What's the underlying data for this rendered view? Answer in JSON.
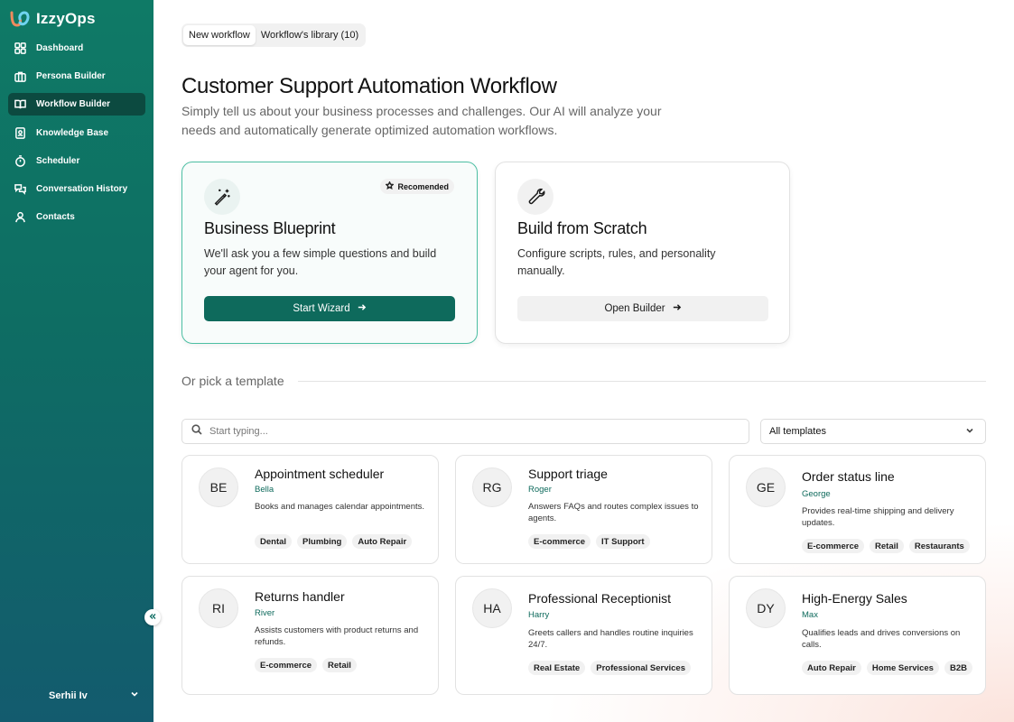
{
  "app": {
    "name": "IzzyOps"
  },
  "sidebar": {
    "items": [
      {
        "label": "Dashboard",
        "icon": "dashboard-grid-icon",
        "active": false
      },
      {
        "label": "Persona Builder",
        "icon": "briefcase-icon",
        "active": false
      },
      {
        "label": "Workflow Builder",
        "icon": "book-open-icon",
        "active": true
      },
      {
        "label": "Knowledge Base",
        "icon": "notebook-icon",
        "active": false
      },
      {
        "label": "Scheduler",
        "icon": "stopwatch-icon",
        "active": false
      },
      {
        "label": "Conversation History",
        "icon": "chat-bubbles-icon",
        "active": false
      },
      {
        "label": "Contacts",
        "icon": "person-icon",
        "active": false
      }
    ],
    "user_name": "Serhii Iv"
  },
  "tabs": [
    {
      "label": "New workflow",
      "active": true
    },
    {
      "label": "Workflow's library (10)",
      "active": false
    }
  ],
  "page": {
    "title": "Customer Support Automation Workflow",
    "subtitle": "Simply tell us about your business processes and challenges. Our AI will analyze your needs and automatically generate optimized automation workflows."
  },
  "options": {
    "blueprint": {
      "badge": "Recomended",
      "title": "Business Blueprint",
      "description": "We'll ask you a few simple questions and build your agent for you.",
      "button": "Start Wizard"
    },
    "scratch": {
      "title": "Build from Scratch",
      "description": "Configure scripts, rules, and personality manually.",
      "button": "Open Builder"
    }
  },
  "templates_section": {
    "heading": "Or pick a template",
    "search_placeholder": "Start typing...",
    "filter_value": "All templates"
  },
  "templates": [
    {
      "initials": "BE",
      "name": "Appointment scheduler",
      "persona": "Bella",
      "description": "Books and manages calendar appointments.",
      "tags": [
        "Dental",
        "Plumbing",
        "Auto Repair"
      ]
    },
    {
      "initials": "RG",
      "name": "Support triage",
      "persona": "Roger",
      "description": "Answers FAQs and routes complex issues to agents.",
      "tags": [
        "E-commerce",
        "IT Support"
      ]
    },
    {
      "initials": "GE",
      "name": "Order status line",
      "persona": "George",
      "description": "Provides real-time shipping and delivery updates.",
      "tags": [
        "E-commerce",
        "Retail",
        "Restaurants"
      ]
    },
    {
      "initials": "RI",
      "name": "Returns handler",
      "persona": "River",
      "description": "Assists customers with product returns and refunds.",
      "tags": [
        "E-commerce",
        "Retail"
      ]
    },
    {
      "initials": "HA",
      "name": "Professional Receptionist",
      "persona": "Harry",
      "description": "Greets callers and handles routine inquiries 24/7.",
      "tags": [
        "Real Estate",
        "Professional Services"
      ]
    },
    {
      "initials": "DY",
      "name": "High-Energy Sales",
      "persona": "Max",
      "description": "Qualifies leads and drives conversions on calls.",
      "tags": [
        "Auto Repair",
        "Home Services",
        "B2B"
      ]
    }
  ],
  "colors": {
    "sidebar_top": "#0f7a66",
    "sidebar_bottom": "#135b6e",
    "accent": "#0e6a5c",
    "featured_border": "#4cbfa3"
  }
}
